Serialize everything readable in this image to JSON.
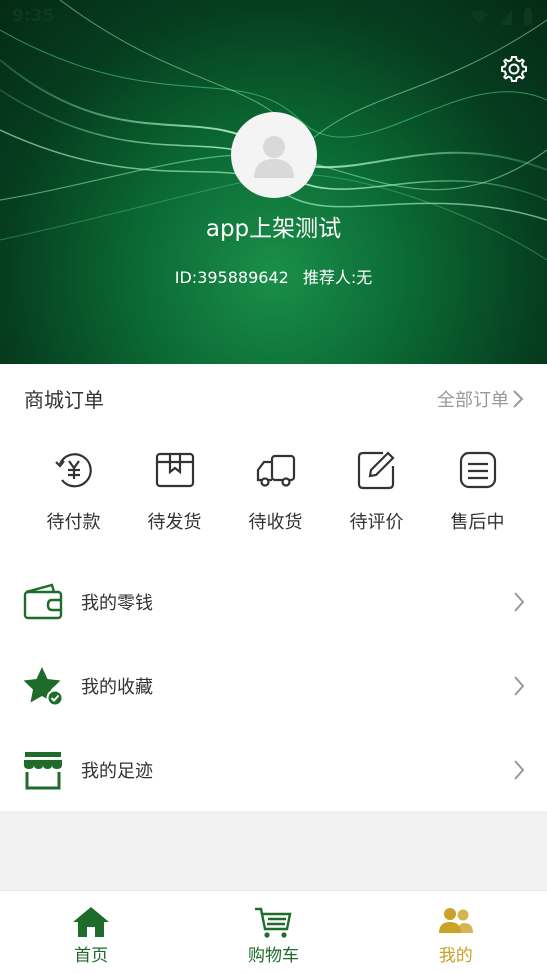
{
  "status_bar": {
    "time": "9:35"
  },
  "profile": {
    "nickname": "app上架测试",
    "id_text": "ID:395889642",
    "referrer_text": "推荐人:无"
  },
  "orders": {
    "title": "商城订单",
    "all_label": "全部订单",
    "items": [
      {
        "label": "待付款",
        "icon": "yen-icon"
      },
      {
        "label": "待发货",
        "icon": "box-icon"
      },
      {
        "label": "待收货",
        "icon": "truck-icon"
      },
      {
        "label": "待评价",
        "icon": "edit-icon"
      },
      {
        "label": "售后中",
        "icon": "list-icon"
      }
    ]
  },
  "menu": [
    {
      "label": "我的零钱",
      "icon": "wallet-icon"
    },
    {
      "label": "我的收藏",
      "icon": "star-icon"
    },
    {
      "label": "我的足迹",
      "icon": "shop-icon"
    }
  ],
  "tabbar": [
    {
      "label": "首页",
      "icon": "home-icon",
      "active": false
    },
    {
      "label": "购物车",
      "icon": "cart-icon",
      "active": false
    },
    {
      "label": "我的",
      "icon": "user-icon",
      "active": true
    }
  ],
  "colors": {
    "brand_green": "#1f6b2a",
    "active_tab": "#c9a227",
    "muted": "#999999"
  }
}
